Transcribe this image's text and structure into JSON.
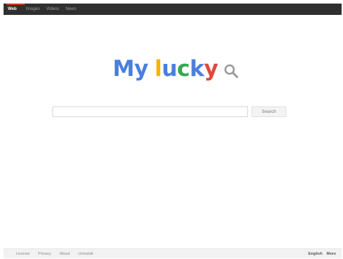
{
  "nav": {
    "items": [
      {
        "label": "Web",
        "active": true
      },
      {
        "label": "Images",
        "active": false
      },
      {
        "label": "Videos",
        "active": false
      },
      {
        "label": "News",
        "active": false
      }
    ],
    "active_accent_color": "#d93025"
  },
  "logo": {
    "text": "My lucky",
    "letters": [
      {
        "char": "M",
        "color": "#4a7fe0"
      },
      {
        "char": "y",
        "color": "#4a7fe0"
      },
      {
        "char": " ",
        "color": "#4a7fe0"
      },
      {
        "char": "l",
        "color": "#f4b400"
      },
      {
        "char": "u",
        "color": "#4a7fe0"
      },
      {
        "char": "c",
        "color": "#34a853"
      },
      {
        "char": "k",
        "color": "#4a7fe0"
      },
      {
        "char": "y",
        "color": "#e0483c"
      }
    ],
    "icon": "magnifier-icon",
    "icon_color": "#9a9a9a"
  },
  "search": {
    "input_value": "",
    "input_placeholder": "",
    "button_label": "Search"
  },
  "footer": {
    "left_links": [
      "License",
      "Privacy",
      "About",
      "Uninstall"
    ],
    "right_links": [
      "English",
      "More"
    ]
  }
}
